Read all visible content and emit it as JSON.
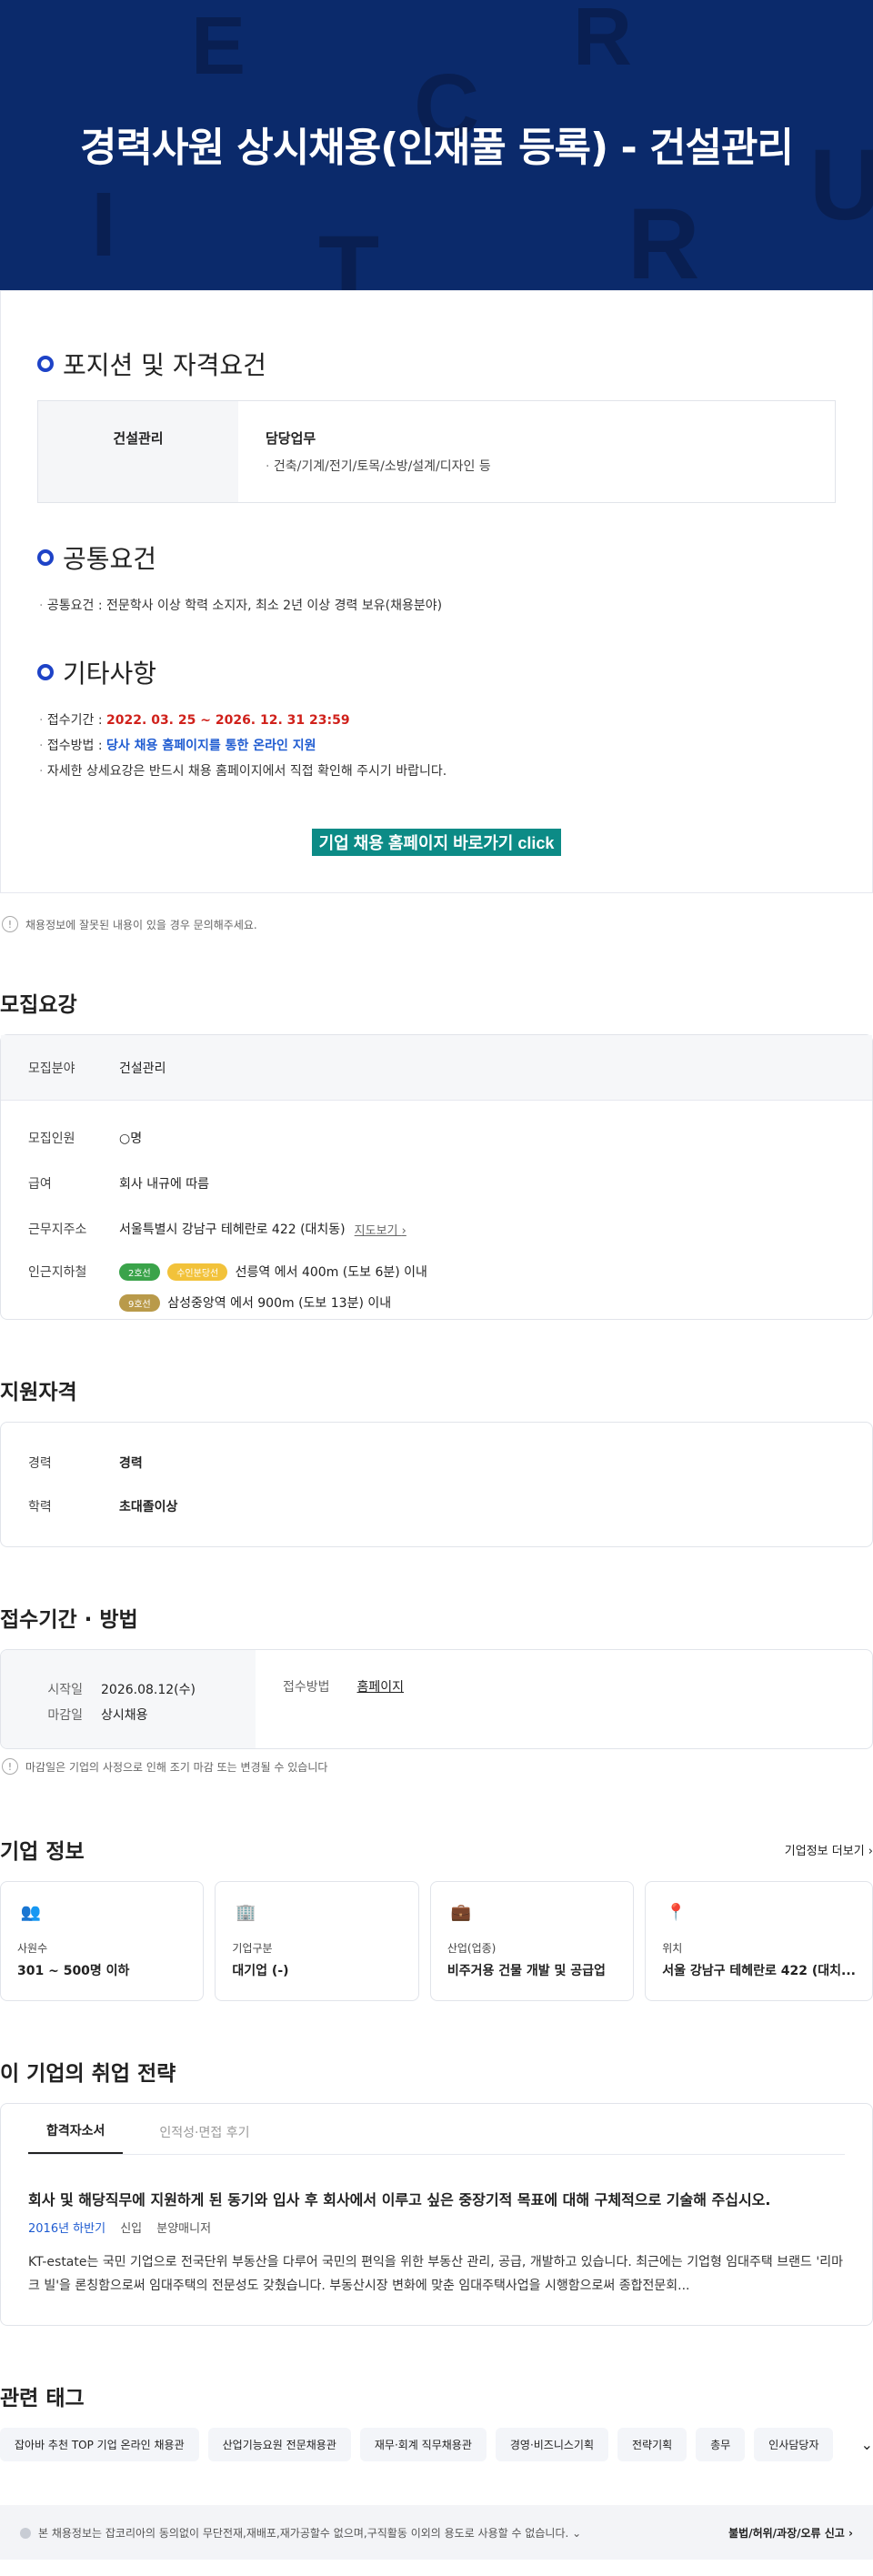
{
  "hero": {
    "title": "경력사원 상시채용(인재풀 등록) - 건설관리",
    "bg_letters": [
      "E",
      "R",
      "C",
      "I",
      "U",
      "R",
      "T",
      "R"
    ]
  },
  "position": {
    "heading": "포지션 및 자격요건",
    "field": "건설관리",
    "duty_label": "담당업무",
    "duty": "건축/기계/전기/토목/소방/설계/디자인 등"
  },
  "common": {
    "heading": "공통요건",
    "text": "공통요건 : 전문학사 이상 학력 소지자, 최소 2년 이상 경력 보유(채용분야)"
  },
  "etc": {
    "heading": "기타사항",
    "period_label": "접수기간 : ",
    "period_value": "2022. 03. 25 ~ 2026. 12. 31  23:59",
    "method_label": "접수방법 : ",
    "method_value": "당사 채용 홈페이지를 통한 온라인 지원",
    "note": "자세한 상세요강은 반드시 채용 홈페이지에서 직접 확인해 주시기 바랍니다.",
    "cta": "기업 채용 홈페이지 바로가기 click"
  },
  "report_text": "채용정보에 잘못된 내용이 있을 경우 문의해주세요.",
  "summary": {
    "heading": "모집요강",
    "field_k": "모집분야",
    "field_v": "건설관리",
    "headcount_k": "모집인원",
    "headcount_v": "○명",
    "pay_k": "급여",
    "pay_v": "회사 내규에 따름",
    "addr_k": "근무지주소",
    "addr_v": "서울특별시 강남구 테헤란로 422 (대치동)",
    "map_link": "지도보기",
    "station_k": "인근지하철",
    "line2": "2호선",
    "line_sb": "수인분당선",
    "line9": "9호선",
    "station1": "선릉역 에서 400m (도보 6분) 이내",
    "station2": "삼성중앙역 에서 900m (도보 13분) 이내"
  },
  "qual": {
    "heading": "지원자격",
    "exp_k": "경력",
    "exp_v": "경력",
    "edu_k": "학력",
    "edu_v": "초대졸이상"
  },
  "apply": {
    "heading": "접수기간 · 방법",
    "start_k": "시작일",
    "start_v": "2026.08.12(수)",
    "end_k": "마감일",
    "end_v": "상시채용",
    "method_k": "접수방법",
    "method_v": "홈페이지",
    "note": "마감일은 기업의 사정으로 인해 조기 마감 또는 변경될 수 있습니다"
  },
  "company": {
    "heading": "기업 정보",
    "more": "기업정보 더보기",
    "cards": [
      {
        "k": "사원수",
        "v": "301 ~ 500명 이하",
        "icon": "people-icon",
        "color": "#5b8def"
      },
      {
        "k": "기업구분",
        "v": "대기업 (-)",
        "icon": "building-icon",
        "color": "#8c98b5"
      },
      {
        "k": "산업(업종)",
        "v": "비주거용 건물 개발 및 공급업",
        "icon": "briefcase-icon",
        "color": "#c0602a"
      },
      {
        "k": "위치",
        "v": "서울 강남구 테헤란로 422 (대치...",
        "icon": "location-pin-icon",
        "color": "#2f6de1"
      }
    ]
  },
  "strategy": {
    "heading": "이 기업의 취업 전략",
    "tab1": "합격자소서",
    "tab2": "인적성·면접 후기",
    "question": "회사 및 해당직무에 지원하게 된 동기와 입사 후 회사에서 이루고 싶은 중장기적 목표에 대해 구체적으로 기술해 주십시오.",
    "year": "2016년 하반기",
    "type": "신입",
    "role": "분양매니저",
    "answer": "KT-estate는 국민 기업으로 전국단위 부동산을 다루어 국민의 편익을 위한 부동산 관리, 공급, 개발하고 있습니다. 최근에는 기업형 임대주택 브랜드 '리마크 빌'을 론칭함으로써 임대주택의 전문성도 갖췄습니다. 부동산시장 변화에 맞춘 임대주택사업을 시행함으로써 종합전문회..."
  },
  "tags": {
    "heading": "관련 태그",
    "items": [
      "잡아바 추천 TOP 기업 온라인 채용관",
      "산업기능요원 전문채용관",
      "재무·회계 직무채용관",
      "경영·비즈니스기획",
      "전략기획",
      "총무",
      "인사담당자"
    ]
  },
  "footer": {
    "notice": "본 채용정보는 잡코리아의 동의없이 무단전재,재배포,재가공할수 없으며,구직활동 이외의 용도로 사용할 수 없습니다.",
    "report": "불법/허위/과장/오류 신고"
  }
}
